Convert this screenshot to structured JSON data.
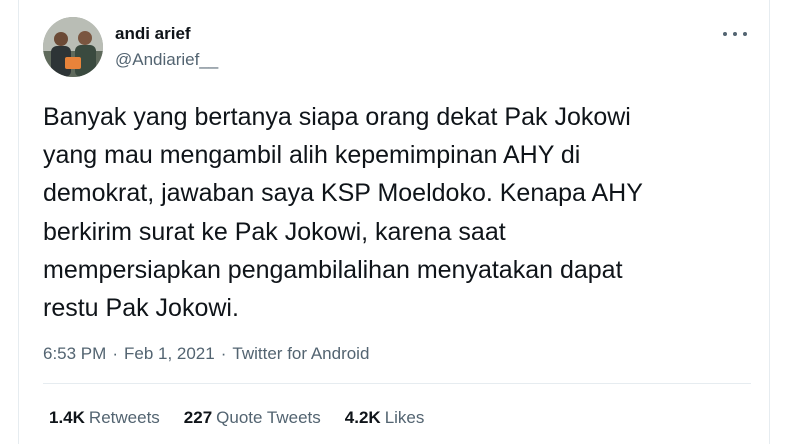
{
  "author": {
    "name": "andi arief",
    "handle": "@Andiarief__",
    "avatar_icon": "profile-photo"
  },
  "more_icon": "more-horizontal-icon",
  "tweet": {
    "text": "Banyak yang bertanya siapa orang dekat Pak Jokowi\nyang mau mengambil alih kepemimpinan AHY di\ndemokrat, jawaban saya KSP Moeldoko. Kenapa AHY\nberkirim surat ke Pak Jokowi, karena saat\nmempersiapkan pengambilalihan menyatakan dapat\nrestu Pak Jokowi."
  },
  "meta": {
    "time": "6:53 PM",
    "separator": "·",
    "date": "Feb 1, 2021",
    "source": "Twitter for Android"
  },
  "stats": {
    "retweets_count": "1.4K",
    "retweets_label": "Retweets",
    "quotes_count": "227",
    "quotes_label": "Quote Tweets",
    "likes_count": "4.2K",
    "likes_label": "Likes"
  },
  "colors": {
    "text_primary": "#0f1419",
    "text_secondary": "#536471",
    "border": "#e6ecf0"
  }
}
